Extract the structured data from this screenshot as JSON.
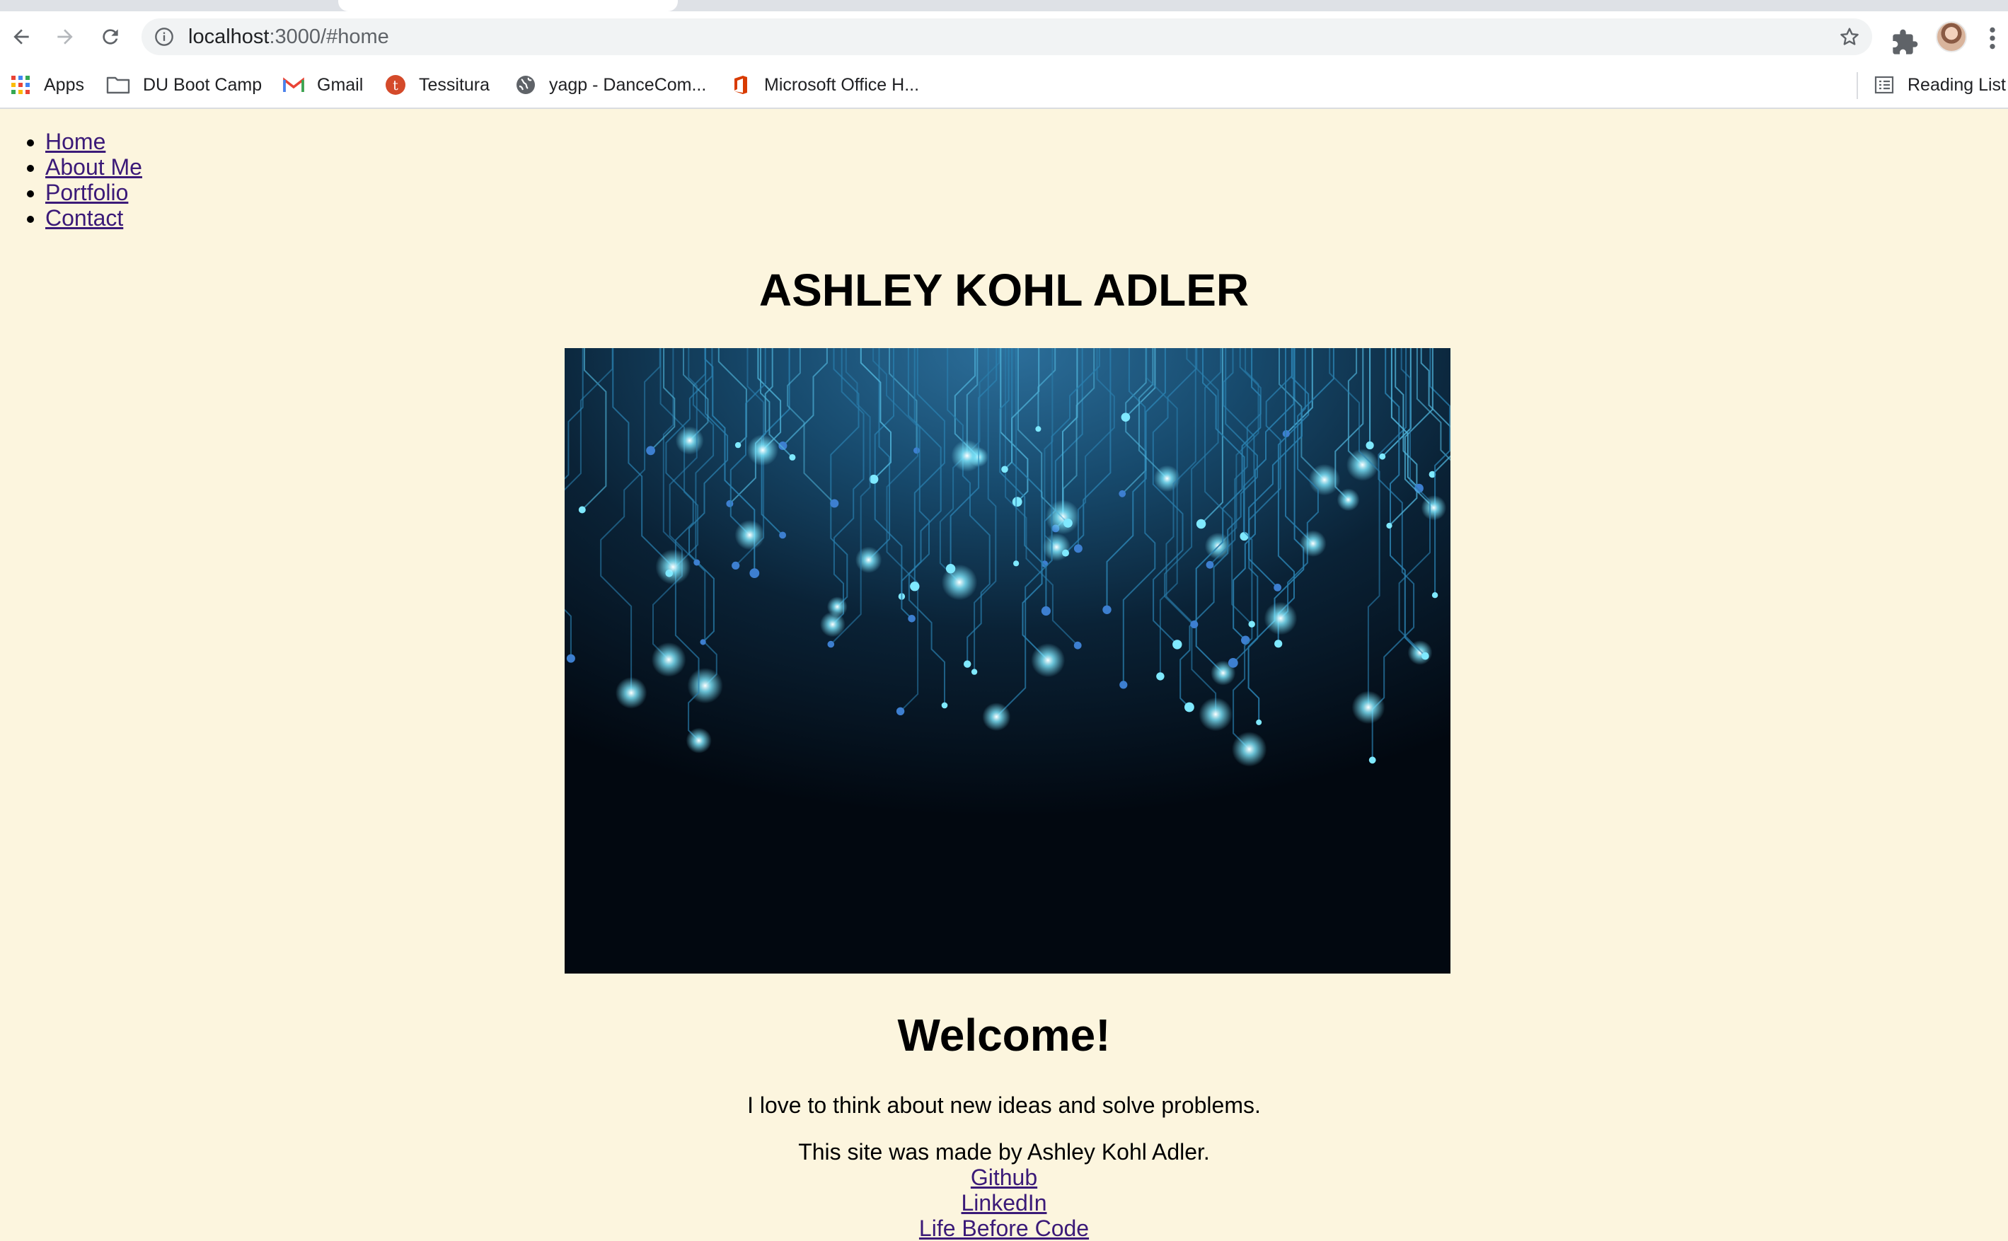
{
  "browser": {
    "url_host": "localhost",
    "url_rest": ":3000/#home",
    "bookmarks": [
      {
        "label": "Apps",
        "icon": "apps-grid-icon"
      },
      {
        "label": "DU Boot Camp",
        "icon": "folder-icon"
      },
      {
        "label": "Gmail",
        "icon": "gmail-icon"
      },
      {
        "label": "Tessitura",
        "icon": "tessitura-icon"
      },
      {
        "label": "yagp - DanceCom...",
        "icon": "globe-icon"
      },
      {
        "label": "Microsoft Office H...",
        "icon": "office-icon"
      }
    ],
    "reading_list": "Reading List"
  },
  "nav": {
    "items": [
      {
        "label": "Home"
      },
      {
        "label": "About Me"
      },
      {
        "label": "Portfolio"
      },
      {
        "label": "Contact"
      }
    ]
  },
  "header": {
    "name": "ASHLEY KOHL ADLER"
  },
  "hero": {
    "description": "circuit-board-image"
  },
  "main": {
    "welcome": "Welcome!",
    "tagline": "I love to think about new ideas and solve problems."
  },
  "footer": {
    "credit": "This site was made by Ashley Kohl Adler.",
    "links": [
      {
        "label": "Github"
      },
      {
        "label": "LinkedIn"
      },
      {
        "label": "Life Before Code"
      }
    ]
  },
  "colors": {
    "page_bg": "#fcf5de",
    "link": "#3b1a78",
    "circuit_glow": "#7fe9ff"
  }
}
